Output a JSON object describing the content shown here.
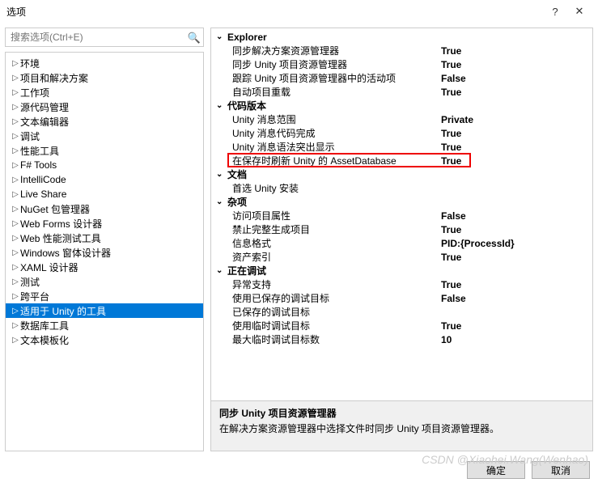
{
  "window": {
    "title": "选项",
    "help": "?",
    "close": "✕"
  },
  "search": {
    "placeholder": "搜索选项(Ctrl+E)"
  },
  "tree": [
    {
      "label": "环境"
    },
    {
      "label": "项目和解决方案"
    },
    {
      "label": "工作项"
    },
    {
      "label": "源代码管理"
    },
    {
      "label": "文本编辑器"
    },
    {
      "label": "调试"
    },
    {
      "label": "性能工具"
    },
    {
      "label": "F# Tools"
    },
    {
      "label": "IntelliCode"
    },
    {
      "label": "Live Share"
    },
    {
      "label": "NuGet 包管理器"
    },
    {
      "label": "Web Forms 设计器"
    },
    {
      "label": "Web 性能测试工具"
    },
    {
      "label": "Windows 窗体设计器"
    },
    {
      "label": "XAML 设计器"
    },
    {
      "label": "测试"
    },
    {
      "label": "跨平台"
    },
    {
      "label": "适用于 Unity 的工具"
    },
    {
      "label": "数据库工具"
    },
    {
      "label": "文本模板化"
    }
  ],
  "selected_tree_index": 17,
  "groups": [
    {
      "name": "Explorer",
      "rows": [
        {
          "name": "同步解决方案资源管理器",
          "value": "True"
        },
        {
          "name": "同步 Unity 项目资源管理器",
          "value": "True"
        },
        {
          "name": "跟踪 Unity 项目资源管理器中的活动项",
          "value": "False"
        },
        {
          "name": "自动项目重载",
          "value": "True"
        }
      ]
    },
    {
      "name": "代码版本",
      "rows": [
        {
          "name": "Unity 消息范围",
          "value": "Private"
        },
        {
          "name": "Unity 消息代码完成",
          "value": "True"
        },
        {
          "name": "Unity 消息语法突出显示",
          "value": "True"
        },
        {
          "name": "在保存时刷新 Unity 的 AssetDatabase",
          "value": "True",
          "highlight": true
        }
      ]
    },
    {
      "name": "文档",
      "rows": [
        {
          "name": "首选 Unity 安装",
          "value": ""
        }
      ]
    },
    {
      "name": "杂项",
      "rows": [
        {
          "name": "访问项目属性",
          "value": "False"
        },
        {
          "name": "禁止完整生成项目",
          "value": "True"
        },
        {
          "name": "信息格式",
          "value": "PID:{ProcessId}"
        },
        {
          "name": "资产索引",
          "value": "True"
        }
      ]
    },
    {
      "name": "正在调试",
      "rows": [
        {
          "name": "异常支持",
          "value": "True"
        },
        {
          "name": "使用已保存的调试目标",
          "value": "False"
        },
        {
          "name": "已保存的调试目标",
          "value": ""
        },
        {
          "name": "使用临时调试目标",
          "value": "True"
        },
        {
          "name": "最大临时调试目标数",
          "value": "10"
        }
      ]
    }
  ],
  "description": {
    "title": "同步 Unity 项目资源管理器",
    "text": "在解决方案资源管理器中选择文件时同步 Unity 项目资源管理器。"
  },
  "buttons": {
    "ok": "确定",
    "cancel": "取消"
  },
  "watermark": "CSDN @Xiaohei.Wang(Wenhao)"
}
